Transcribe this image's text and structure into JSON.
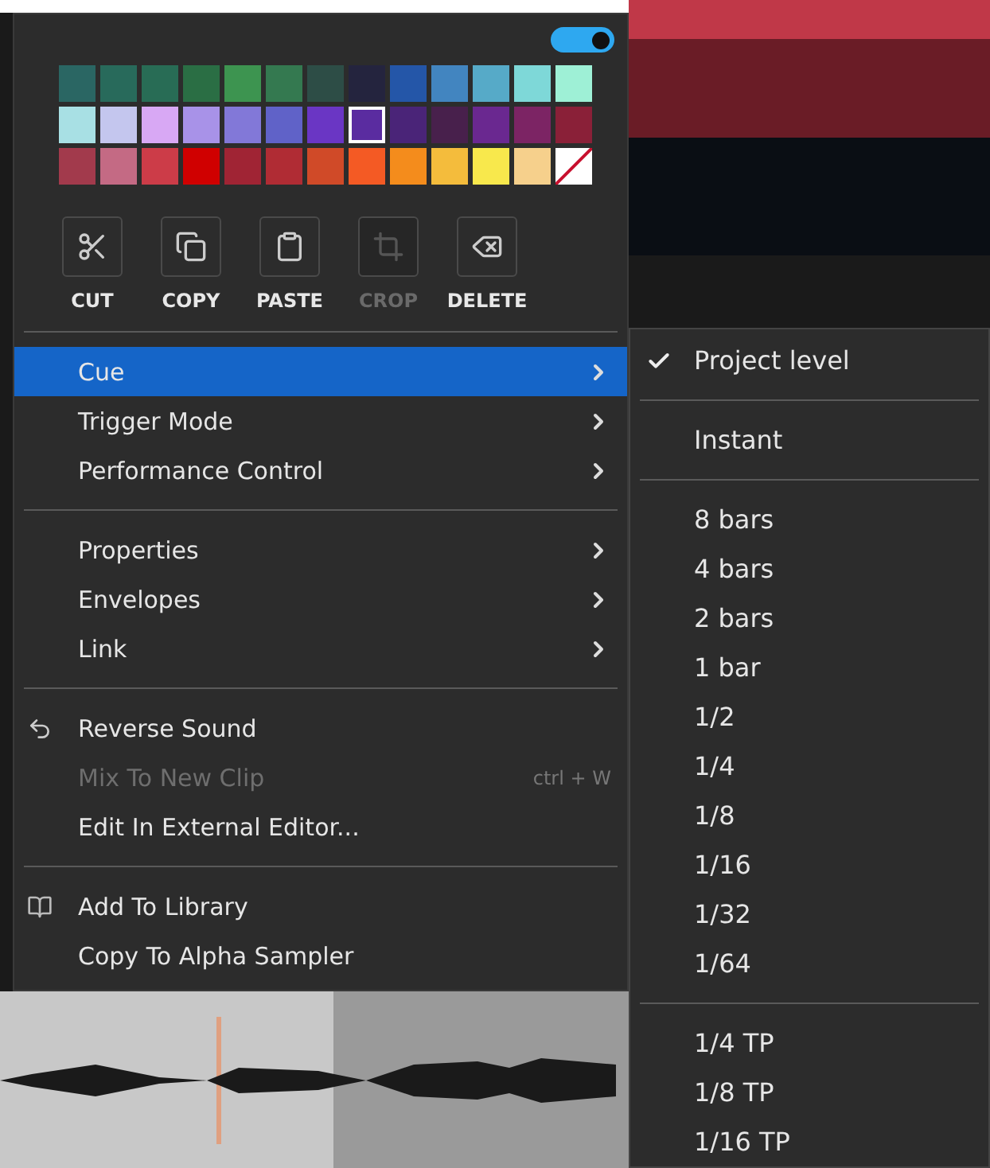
{
  "toggle": {
    "on": true
  },
  "palette": {
    "swatches": [
      {
        "color": "#2a6663",
        "selected": false
      },
      {
        "color": "#286a5b",
        "selected": false
      },
      {
        "color": "#286c55",
        "selected": false
      },
      {
        "color": "#2a6e44",
        "selected": false
      },
      {
        "color": "#3d9450",
        "selected": false
      },
      {
        "color": "#347950",
        "selected": false
      },
      {
        "color": "#2d4d46",
        "selected": false
      },
      {
        "color": "#24243e",
        "selected": false
      },
      {
        "color": "#2456a8",
        "selected": false
      },
      {
        "color": "#4285c0",
        "selected": false
      },
      {
        "color": "#56aac8",
        "selected": false
      },
      {
        "color": "#7ed8d8",
        "selected": false
      },
      {
        "color": "#9ef0d6",
        "selected": false
      },
      {
        "color": "#a8e0e4",
        "selected": false
      },
      {
        "color": "#c4c6ee",
        "selected": false
      },
      {
        "color": "#d8a8f4",
        "selected": false
      },
      {
        "color": "#a892e8",
        "selected": false
      },
      {
        "color": "#8278d8",
        "selected": false
      },
      {
        "color": "#6062c8",
        "selected": false
      },
      {
        "color": "#6a36c4",
        "selected": false
      },
      {
        "color": "#5a2ca0",
        "selected": true
      },
      {
        "color": "#4a2478",
        "selected": false
      },
      {
        "color": "#48204c",
        "selected": false
      },
      {
        "color": "#6a2890",
        "selected": false
      },
      {
        "color": "#7c2464",
        "selected": false
      },
      {
        "color": "#8a2038",
        "selected": false
      },
      {
        "color": "#a23a4c",
        "selected": false
      },
      {
        "color": "#c46a84",
        "selected": false
      },
      {
        "color": "#cc3c48",
        "selected": false
      },
      {
        "color": "#d00000",
        "selected": false
      },
      {
        "color": "#a02434",
        "selected": false
      },
      {
        "color": "#b02c34",
        "selected": false
      },
      {
        "color": "#d04a28",
        "selected": false
      },
      {
        "color": "#f45a24",
        "selected": false
      },
      {
        "color": "#f48c1c",
        "selected": false
      },
      {
        "color": "#f4bc3c",
        "selected": false
      },
      {
        "color": "#f8e84c",
        "selected": false
      },
      {
        "color": "#f6d08c",
        "selected": false
      },
      {
        "kind": "none",
        "selected": false
      }
    ]
  },
  "tools": [
    {
      "label": "CUT",
      "disabled": false
    },
    {
      "label": "COPY",
      "disabled": false
    },
    {
      "label": "PASTE",
      "disabled": false
    },
    {
      "label": "CROP",
      "disabled": true
    },
    {
      "label": "DELETE",
      "disabled": false
    }
  ],
  "menu_sections": [
    [
      {
        "label": "Cue",
        "submenu": true,
        "highlighted": true,
        "disabled": false
      },
      {
        "label": "Trigger Mode",
        "submenu": true,
        "highlighted": false,
        "disabled": false
      },
      {
        "label": "Performance Control",
        "submenu": true,
        "highlighted": false,
        "disabled": false
      }
    ],
    [
      {
        "label": "Properties",
        "submenu": true,
        "highlighted": false,
        "disabled": false
      },
      {
        "label": "Envelopes",
        "submenu": true,
        "highlighted": false,
        "disabled": false
      },
      {
        "label": "Link",
        "submenu": true,
        "highlighted": false,
        "disabled": false
      }
    ],
    [
      {
        "label": "Reverse Sound",
        "submenu": false,
        "highlighted": false,
        "disabled": false
      },
      {
        "label": "Mix To New Clip",
        "submenu": false,
        "highlighted": false,
        "disabled": true,
        "shortcut": "ctrl + W"
      },
      {
        "label": "Edit In External Editor...",
        "submenu": false,
        "highlighted": false,
        "disabled": false
      }
    ],
    [
      {
        "label": "Add To Library",
        "submenu": false,
        "highlighted": false,
        "disabled": false
      },
      {
        "label": "Copy To Alpha Sampler",
        "submenu": false,
        "highlighted": false,
        "disabled": false
      }
    ]
  ],
  "submenu_sections": [
    [
      {
        "label": "Project level",
        "checked": true
      }
    ],
    [
      {
        "label": "Instant",
        "checked": false
      }
    ],
    [
      {
        "label": "8 bars",
        "checked": false
      },
      {
        "label": "4 bars",
        "checked": false
      },
      {
        "label": "2 bars",
        "checked": false
      },
      {
        "label": "1 bar",
        "checked": false
      },
      {
        "label": "1/2",
        "checked": false
      },
      {
        "label": "1/4",
        "checked": false
      },
      {
        "label": "1/8",
        "checked": false
      },
      {
        "label": "1/16",
        "checked": false
      },
      {
        "label": "1/32",
        "checked": false
      },
      {
        "label": "1/64",
        "checked": false
      }
    ],
    [
      {
        "label": "1/4 TP",
        "checked": false
      },
      {
        "label": "1/8 TP",
        "checked": false
      },
      {
        "label": "1/16 TP",
        "checked": false
      }
    ]
  ]
}
